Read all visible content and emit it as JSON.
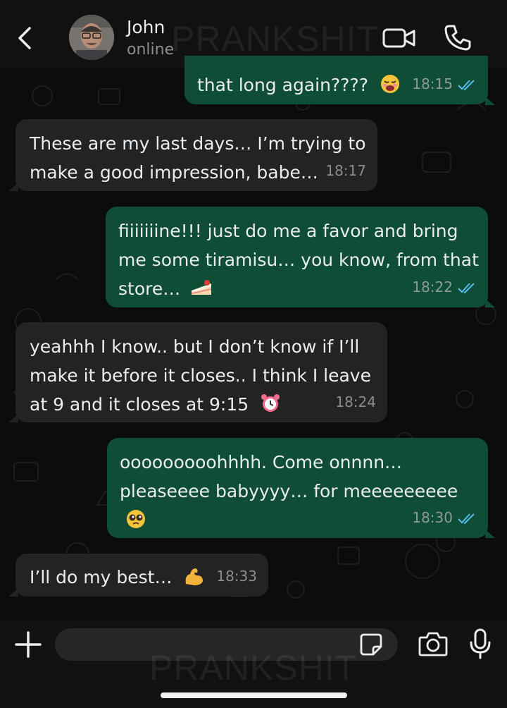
{
  "header": {
    "contact_name": "John",
    "status": "online",
    "watermark": "PRANKSHIT"
  },
  "messages": [
    {
      "direction": "out",
      "text": "that long again????",
      "emoji": "weary-face-emoji",
      "time": "18:15",
      "read": true
    },
    {
      "direction": "in",
      "lines": [
        "These are my last days… I’m trying to",
        "make a good impression, babe…"
      ],
      "time": "18:17"
    },
    {
      "direction": "out",
      "lines": [
        "fiiiiiiine!!! just do me a favor and bring",
        "me some tiramisu… you know, from that",
        "store…"
      ],
      "emoji": "shortcake-emoji",
      "time": "18:22",
      "read": true
    },
    {
      "direction": "in",
      "lines": [
        "yeahhh I know.. but I don’t know if I’ll",
        "make it before it closes.. I think I leave",
        "at 9 and it closes at 9:15"
      ],
      "emoji": "alarm-clock-emoji",
      "time": "18:24"
    },
    {
      "direction": "out",
      "lines": [
        "ooooooooohhhh. Come onnnn…",
        "pleaseeee babyyyy… for meeeeeeeee"
      ],
      "emoji": "pleading-face-emoji",
      "time": "18:30",
      "read": true
    },
    {
      "direction": "in",
      "text": "I’ll do my best…",
      "emoji": "flexed-biceps-emoji",
      "time": "18:33"
    }
  ],
  "composer": {
    "placeholder": "",
    "watermark": "PRANKSHIT"
  },
  "colors": {
    "outgoing_bubble": "#0f4d36",
    "incoming_bubble": "#232323",
    "read_ticks": "#53bdeb",
    "background": "#0c0c0c"
  }
}
